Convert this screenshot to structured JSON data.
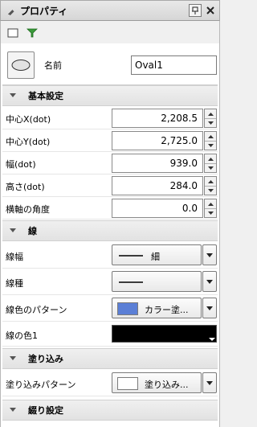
{
  "window": {
    "title": "プロパティ",
    "title_icon": "pencil-icon",
    "buttons": [
      "pin-icon",
      "close-icon"
    ]
  },
  "toolbar": {
    "tools": [
      "checkbox-icon",
      "filter-icon"
    ]
  },
  "object": {
    "label": "名前",
    "name": "Oval1",
    "thumb_icon": "ellipse-icon"
  },
  "sections": {
    "basic": {
      "label": "基本設定"
    },
    "line": {
      "label": "線"
    },
    "fill": {
      "label": "塗り込み"
    },
    "weave": {
      "label": "綴り設定"
    }
  },
  "basic_rows": [
    {
      "label": "中心X(dot)",
      "value": "2,208.5"
    },
    {
      "label": "中心Y(dot)",
      "value": "2,725.0"
    },
    {
      "label": "幅(dot)",
      "value": "939.0"
    },
    {
      "label": "高さ(dot)",
      "value": "284.0"
    },
    {
      "label": "横軸の角度",
      "value": "0.0"
    }
  ],
  "line_rows": {
    "width": {
      "label": "線幅",
      "value": "細"
    },
    "type": {
      "label": "線種",
      "value": ""
    },
    "pattern": {
      "label": "線色のパターン",
      "value": "カラー塗...",
      "color": "#5b7fd6"
    },
    "color1": {
      "label": "線の色1",
      "color": "#000000"
    }
  },
  "fill_rows": {
    "pattern": {
      "label": "塗り込みパターン",
      "value": "塗り込み...",
      "color": "#ffffff"
    }
  }
}
